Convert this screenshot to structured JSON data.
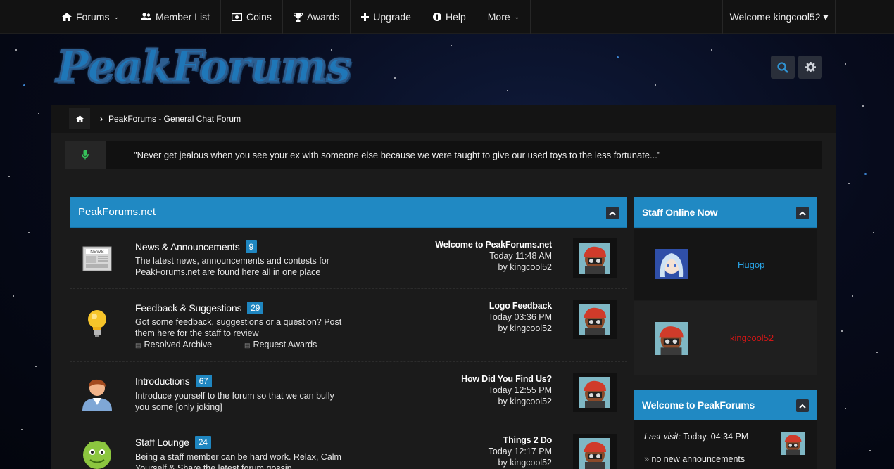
{
  "nav": {
    "items": [
      {
        "label": "Forums",
        "icon": "home-icon",
        "caret": true
      },
      {
        "label": "Member List",
        "icon": "users-icon",
        "caret": false
      },
      {
        "label": "Coins",
        "icon": "money-icon",
        "caret": false
      },
      {
        "label": "Awards",
        "icon": "trophy-icon",
        "caret": false
      },
      {
        "label": "Upgrade",
        "icon": "plus-icon",
        "caret": false
      },
      {
        "label": "Help",
        "icon": "info-icon",
        "caret": false
      },
      {
        "label": "More",
        "icon": "",
        "caret": true
      }
    ],
    "welcome": "Welcome kingcool52 ▾"
  },
  "header": {
    "logo_text": "PeakForums",
    "search_icon": "search-icon",
    "settings_icon": "gear-icon"
  },
  "breadcrumb": {
    "current": "PeakForums - General Chat Forum"
  },
  "quote": {
    "text": "\"Never get jealous when you see your ex with someone else because we were taught to give our used toys to the less fortunate...\""
  },
  "forums_panel": {
    "title": "PeakForums.net",
    "forums": [
      {
        "title": "News & Announcements",
        "count": "9",
        "icon": "newspaper-icon",
        "desc1": "The latest news, announcements and contests for",
        "desc2": "PeakForums.net are found here all in one place",
        "last_title": "Welcome to PeakForums.net",
        "last_time": "Today 11:48 AM",
        "last_by": "by kingcool52"
      },
      {
        "title": "Feedback & Suggestions",
        "count": "29",
        "icon": "lightbulb-icon",
        "desc1": "Got some feedback, suggestions or a question? Post",
        "desc2": "them here for the staff to review",
        "subforums": [
          "Resolved Archive",
          "Request Awards"
        ],
        "last_title": "Logo Feedback",
        "last_time": "Today 03:36 PM",
        "last_by": "by kingcool52"
      },
      {
        "title": "Introductions",
        "count": "67",
        "icon": "person-icon",
        "desc1": "Introduce yourself to the forum so that we can bully",
        "desc2": "you some [only joking]",
        "last_title": "How Did You Find Us?",
        "last_time": "Today 12:55 PM",
        "last_by": "by kingcool52"
      },
      {
        "title": "Staff Lounge",
        "count": "24",
        "icon": "android-icon",
        "desc1": "Being a staff member can be hard work. Relax, Calm",
        "desc2": "Yourself & Share the latest forum gossip",
        "last_title": "Things 2 Do",
        "last_time": "Today 12:17 PM",
        "last_by": "by kingcool52"
      }
    ]
  },
  "staff_panel": {
    "title": "Staff Online Now",
    "members": [
      {
        "name": "Hugop",
        "color": "#2aa6e8"
      },
      {
        "name": "kingcool52",
        "color": "#d01616"
      }
    ]
  },
  "welcome_panel": {
    "title": "Welcome to PeakForums",
    "last_visit_label": "Last visit:",
    "last_visit_value": " Today, 04:34 PM",
    "announce": "» no new announcements"
  },
  "colors": {
    "accent": "#2089c3",
    "nav_bg": "#121212",
    "panel_bg": "#1b1b1b"
  }
}
